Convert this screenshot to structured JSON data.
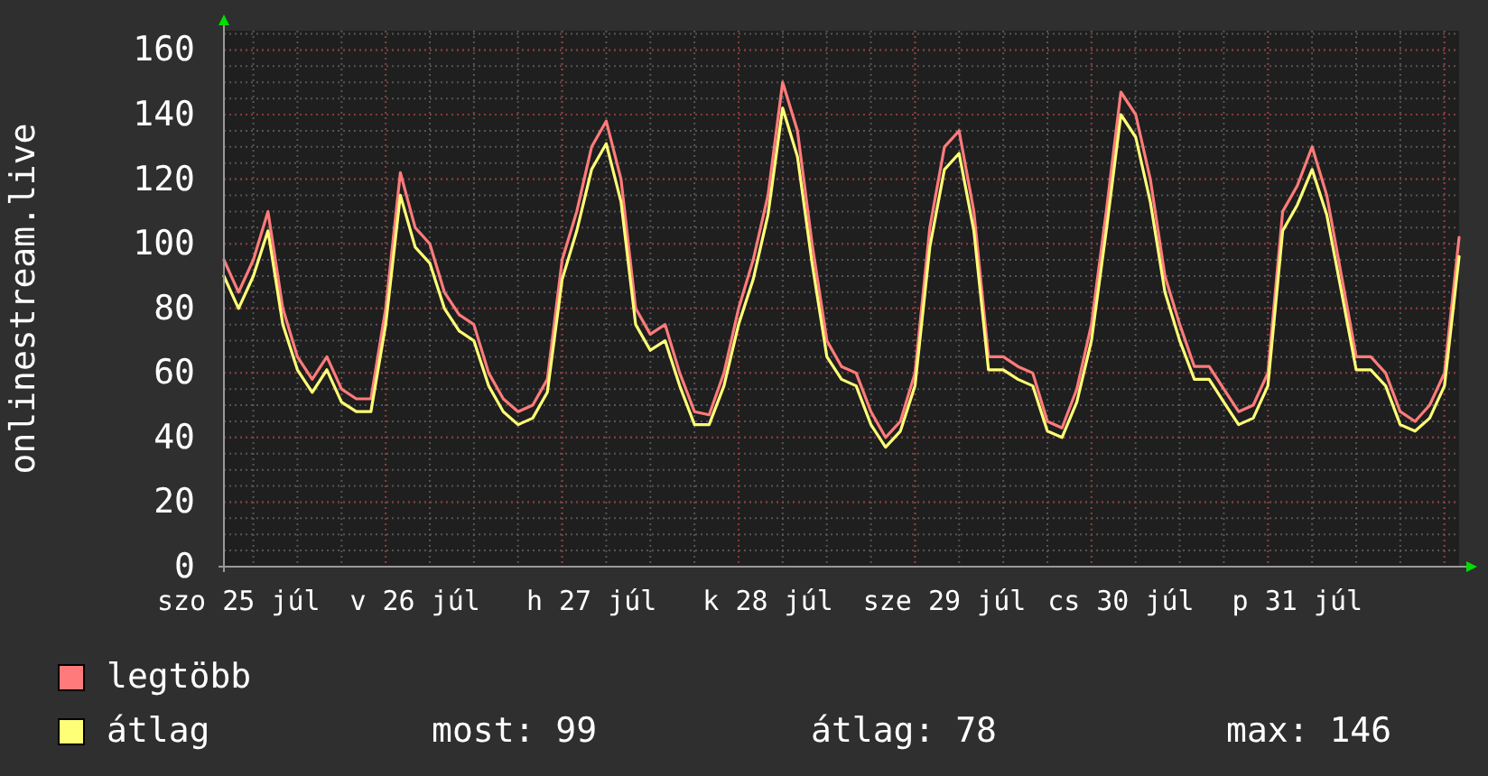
{
  "chart": {
    "chart_data": {
      "type": "line",
      "ylabel": "onlinestream.live",
      "categories": [
        null,
        "szo 25 júl",
        null,
        null,
        null,
        null,
        null,
        null,
        null,
        null,
        null,
        null,
        null,
        "v 26 júl",
        null,
        null,
        null,
        null,
        null,
        null,
        null,
        null,
        null,
        null,
        null,
        "h 27 júl",
        null,
        null,
        null,
        null,
        null,
        null,
        null,
        null,
        null,
        null,
        null,
        "k 28 júl",
        null,
        null,
        null,
        null,
        null,
        null,
        null,
        null,
        null,
        null,
        null,
        "sze 29 júl",
        null,
        null,
        null,
        null,
        null,
        null,
        null,
        null,
        null,
        null,
        null,
        "cs 30 júl",
        null,
        null,
        null,
        null,
        null,
        null,
        null,
        null,
        null,
        null,
        null,
        "p 31 júl",
        null,
        null,
        null,
        null,
        null,
        null,
        null,
        null,
        null,
        null,
        null
      ],
      "series": [
        {
          "name": "legtöbb",
          "color": "#ff7b7b",
          "values": [
            95,
            85,
            95,
            110,
            80,
            65,
            58,
            65,
            55,
            52,
            52,
            80,
            122,
            105,
            100,
            85,
            78,
            75,
            60,
            52,
            48,
            50,
            58,
            95,
            110,
            130,
            138,
            120,
            80,
            72,
            75,
            60,
            48,
            47,
            60,
            80,
            95,
            115,
            150,
            135,
            100,
            70,
            62,
            60,
            48,
            40,
            45,
            60,
            105,
            130,
            135,
            110,
            65,
            65,
            62,
            60,
            45,
            43,
            55,
            75,
            110,
            147,
            140,
            120,
            90,
            75,
            62,
            62,
            55,
            48,
            50,
            60,
            110,
            118,
            130,
            115,
            90,
            65,
            65,
            60,
            48,
            45,
            50,
            60,
            102
          ]
        },
        {
          "name": "átlag",
          "color": "#ffff77",
          "values": [
            90,
            80,
            90,
            104,
            75,
            61,
            54,
            61,
            51,
            48,
            48,
            75,
            115,
            99,
            94,
            80,
            73,
            70,
            56,
            48,
            44,
            46,
            54,
            89,
            104,
            123,
            131,
            113,
            75,
            67,
            70,
            56,
            44,
            44,
            56,
            75,
            89,
            109,
            142,
            127,
            94,
            65,
            58,
            56,
            44,
            37,
            42,
            56,
            99,
            123,
            128,
            104,
            61,
            61,
            58,
            56,
            42,
            40,
            51,
            70,
            104,
            140,
            133,
            113,
            85,
            70,
            58,
            58,
            51,
            44,
            46,
            56,
            104,
            112,
            123,
            109,
            85,
            61,
            61,
            56,
            44,
            42,
            46,
            56,
            96
          ]
        }
      ],
      "ylim": [
        0,
        166
      ],
      "grid": true,
      "yticks": [
        0,
        20,
        40,
        60,
        80,
        100,
        120,
        140,
        160
      ]
    }
  },
  "legend": {
    "stats": [
      "most: 99",
      "átlag: 78",
      "max: 146"
    ]
  }
}
